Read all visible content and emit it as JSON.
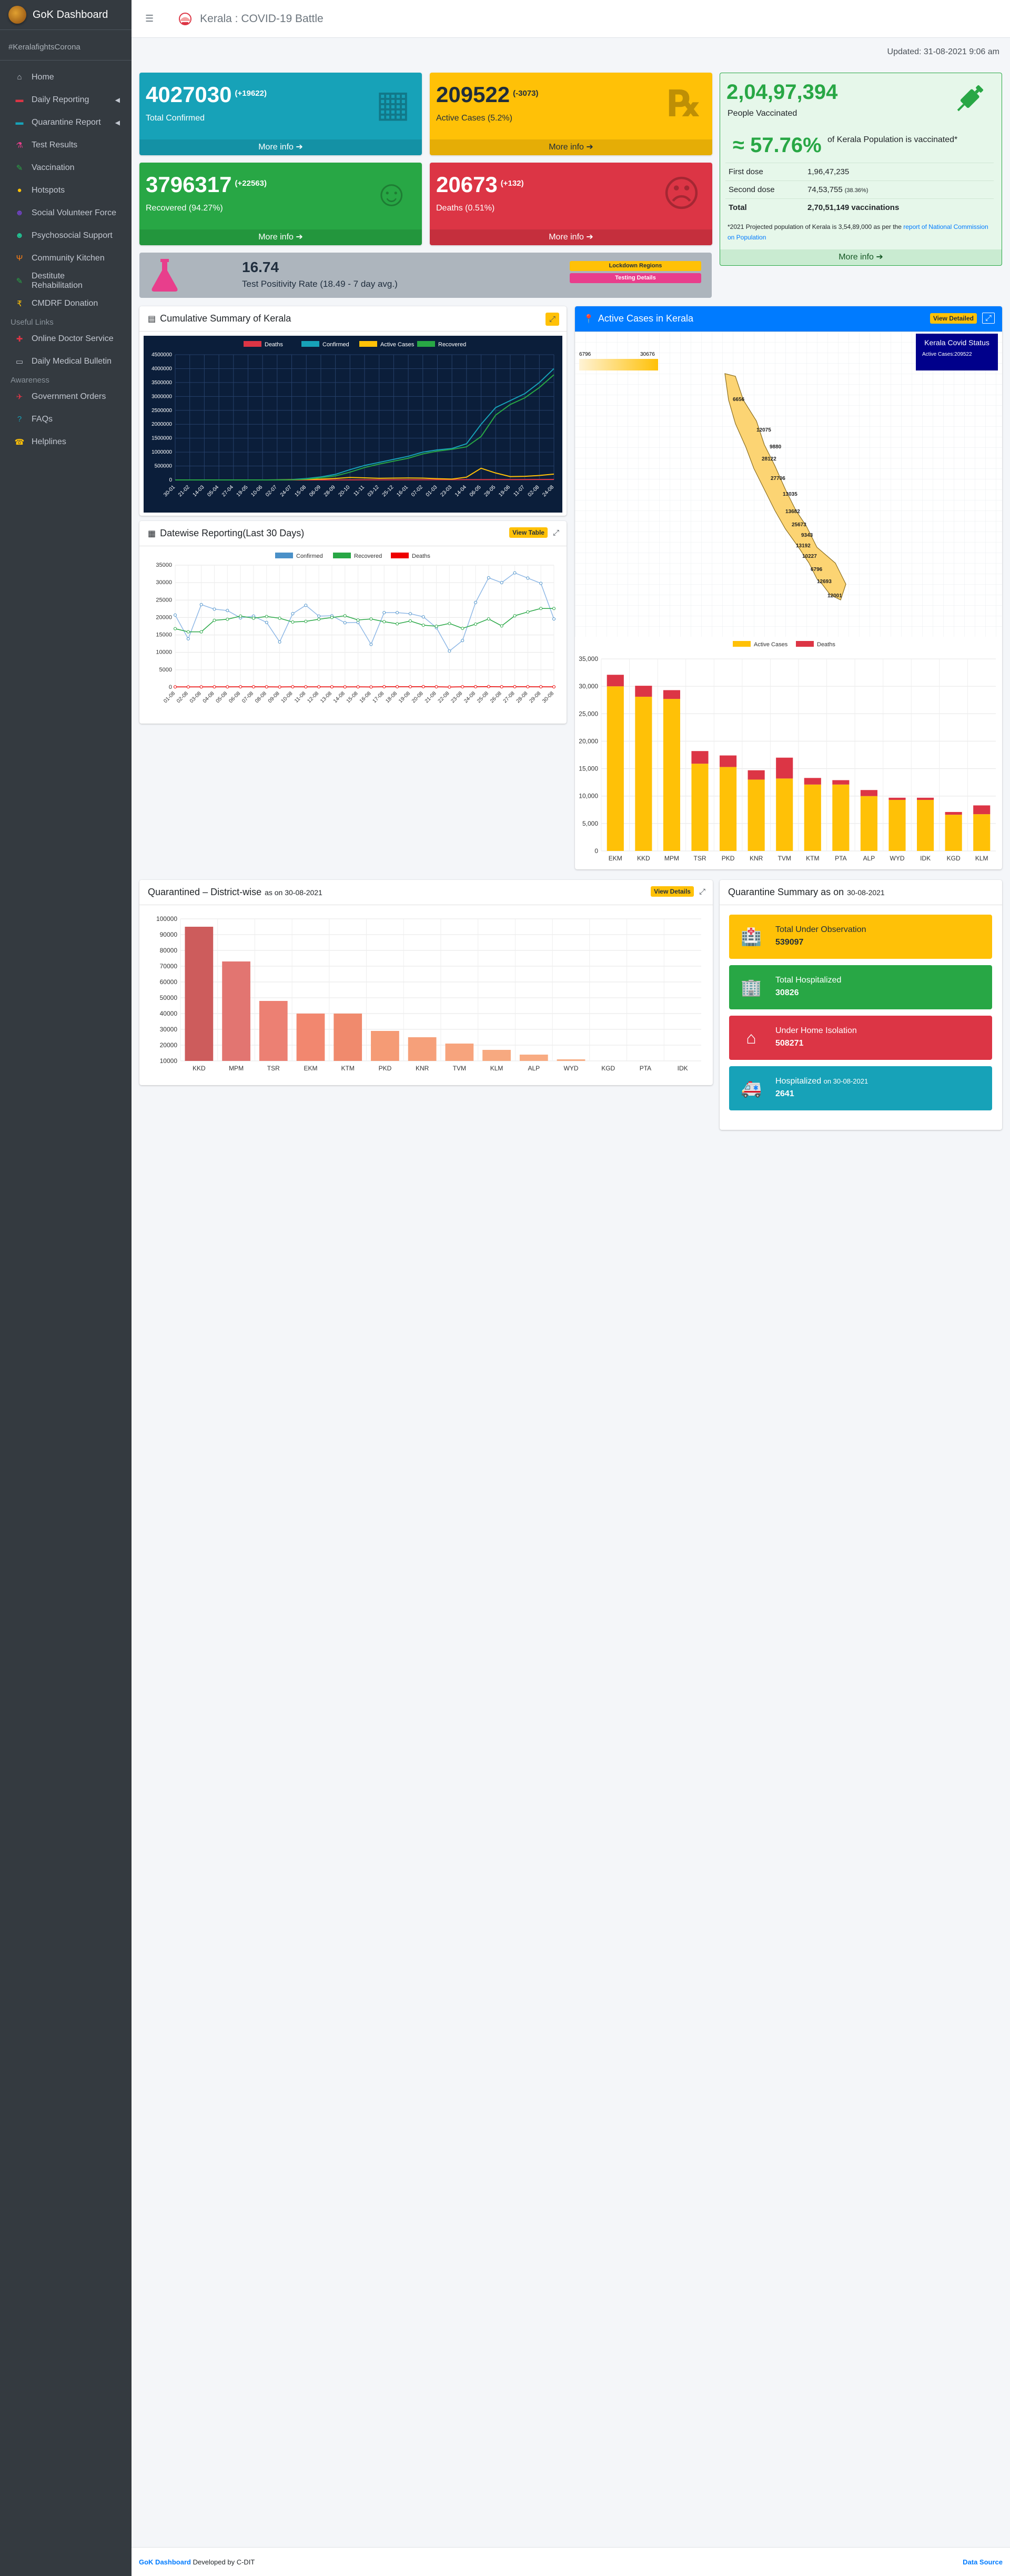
{
  "sidebar": {
    "brand": "GoK Dashboard",
    "hashtag": "#KeralafightsCorona",
    "items": [
      {
        "label": "Home",
        "icon": "⌂",
        "color": "#c2c7d0"
      },
      {
        "label": "Daily Reporting",
        "icon": "▬",
        "color": "#dc3545",
        "caret": true
      },
      {
        "label": "Quarantine Report",
        "icon": "▬",
        "color": "#17a2b8",
        "caret": true
      },
      {
        "label": "Test Results",
        "icon": "⚗",
        "color": "#e83e8c"
      },
      {
        "label": "Vaccination",
        "icon": "✎",
        "color": "#28a745"
      },
      {
        "label": "Hotspots",
        "icon": "●",
        "color": "#ffc107"
      },
      {
        "label": "Social Volunteer Force",
        "icon": "☻",
        "color": "#6f42c1"
      },
      {
        "label": "Psychosocial Support",
        "icon": "☻",
        "color": "#20c997"
      },
      {
        "label": "Community Kitchen",
        "icon": "Ψ",
        "color": "#fd7e14"
      },
      {
        "label": "Destitute Rehabilitation",
        "icon": "✎",
        "color": "#28a745"
      },
      {
        "label": "CMDRF Donation",
        "icon": "₹",
        "color": "#ffc107"
      }
    ],
    "useful_header": "Useful Links",
    "useful": [
      {
        "label": "Online Doctor Service",
        "icon": "✚",
        "color": "#dc3545"
      },
      {
        "label": "Daily Medical Bulletin",
        "icon": "▭",
        "color": "#c2c7d0"
      }
    ],
    "awareness_header": "Awareness",
    "awareness": [
      {
        "label": "Government Orders",
        "icon": "✈",
        "color": "#dc3545"
      },
      {
        "label": "FAQs",
        "icon": "?",
        "color": "#17a2b8"
      },
      {
        "label": "Helplines",
        "icon": "☎",
        "color": "#ffc107"
      }
    ]
  },
  "header": {
    "title": "Kerala : COVID-19 Battle"
  },
  "updated": "Updated: 31-08-2021 9:06 am",
  "boxes": {
    "confirmed": {
      "value": "4027030",
      "delta": "(+19622)",
      "label": "Total Confirmed",
      "more": "More info ➔"
    },
    "active": {
      "value": "209522",
      "delta": "(-3073)",
      "label": "Active Cases (5.2%)",
      "more": "More info ➔"
    },
    "recovered": {
      "value": "3796317",
      "delta": "(+22563)",
      "label": "Recovered (94.27%)",
      "more": "More info ➔"
    },
    "deaths": {
      "value": "20673",
      "delta": "(+132)",
      "label": "Deaths (0.51%)",
      "more": "More info ➔"
    }
  },
  "vaccination": {
    "people": "2,04,97,394",
    "people_label": "People Vaccinated",
    "pct": "≈ 57.76%",
    "pct_label": "of Kerala Population is vaccinated*",
    "rows": [
      {
        "k": "First dose",
        "v": "1,96,47,235",
        "extra": ""
      },
      {
        "k": "Second dose",
        "v": "74,53,755",
        "extra": "(38.36%)"
      },
      {
        "k": "Total",
        "v": "2,70,51,149 vaccinations",
        "extra": ""
      }
    ],
    "note": "*2021 Projected population of Kerala is 3,54,89,000 as per the",
    "note_link": "report of National Commission on Population",
    "more": "More info ➔"
  },
  "tpr": {
    "value": "16.74",
    "label": "Test Positivity Rate (18.49 - 7 day avg.)",
    "btn1": "Lockdown Regions",
    "btn2": "Testing Details"
  },
  "cumulative": {
    "title": "Cumulative Summary of Kerala",
    "legend": [
      "Deaths",
      "Confirmed",
      "Active Cases",
      "Recovered"
    ],
    "colors": [
      "#dc3545",
      "#17a2b8",
      "#ffc107",
      "#28a745"
    ]
  },
  "datewise": {
    "title": "Datewise Reporting(Last 30 Days)",
    "btn": "View Table",
    "legend": [
      "Confirmed",
      "Recovered",
      "Deaths"
    ],
    "colors": [
      "#4a90c8",
      "#28a745",
      "#e00"
    ]
  },
  "map": {
    "title": "Active Cases in Kerala",
    "btn": "View Detailed",
    "status_title": "Kerala Covid Status",
    "status_sub": "Active Cases:209522",
    "scale_min": "6796",
    "scale_max": "30676",
    "labels": [
      "6656",
      "12075",
      "9880",
      "28122",
      "27706",
      "13035",
      "13682",
      "25673",
      "9343",
      "13192",
      "10227",
      "6796",
      "12693",
      "12001"
    ]
  },
  "chart_data": [
    {
      "type": "line",
      "id": "cumulative",
      "title": "Cumulative Summary of Kerala",
      "yticks": [
        "4500000",
        "4000000",
        "3500000",
        "3000000",
        "2500000",
        "2000000",
        "1500000",
        "1000000",
        "500000",
        "0"
      ],
      "ylim": [
        0,
        4500000
      ],
      "x": [
        "30-01",
        "21-02",
        "14-03",
        "05-04",
        "27-04",
        "19-05",
        "10-06",
        "02-07",
        "24-07",
        "15-08",
        "06-09",
        "28-09",
        "20-10",
        "11-11",
        "03-12",
        "25-12",
        "16-01",
        "07-02",
        "01-03",
        "23-03",
        "14-04",
        "06-05",
        "28-05",
        "19-06",
        "11-07",
        "02-08",
        "24-08"
      ],
      "series": [
        {
          "name": "Deaths",
          "values": [
            0,
            0,
            0,
            0,
            0,
            0,
            0,
            0,
            100,
            400,
            1000,
            2000,
            3000,
            4000,
            5000,
            6000,
            7000,
            8000,
            9000,
            10000,
            11000,
            12000,
            13000,
            14000,
            15000,
            17000,
            20000
          ]
        },
        {
          "name": "Confirmed",
          "values": [
            0,
            0,
            0,
            0,
            0,
            0,
            0,
            2000,
            15000,
            50000,
            110000,
            200000,
            370000,
            520000,
            630000,
            740000,
            850000,
            1000000,
            1080000,
            1130000,
            1300000,
            2000000,
            2600000,
            2850000,
            3100000,
            3500000,
            4000000
          ]
        },
        {
          "name": "Active Cases",
          "values": [
            0,
            0,
            0,
            0,
            0,
            0,
            0,
            1500,
            10000,
            20000,
            30000,
            55000,
            90000,
            75000,
            60000,
            65000,
            70000,
            65000,
            45000,
            30000,
            100000,
            420000,
            250000,
            120000,
            130000,
            160000,
            210000
          ]
        },
        {
          "name": "Recovered",
          "values": [
            0,
            0,
            0,
            0,
            0,
            0,
            0,
            500,
            5000,
            30000,
            80000,
            145000,
            280000,
            445000,
            570000,
            675000,
            780000,
            935000,
            1035000,
            1100000,
            1190000,
            1560000,
            2330000,
            2710000,
            2950000,
            3320000,
            3780000
          ]
        }
      ]
    },
    {
      "type": "line",
      "id": "datewise",
      "title": "Datewise Reporting(Last 30 Days)",
      "yticks": [
        "35000",
        "30000",
        "25000",
        "20000",
        "15000",
        "10000",
        "5000",
        "0"
      ],
      "ylim": [
        0,
        35000
      ],
      "x": [
        "01-08",
        "02-08",
        "03-08",
        "04-08",
        "05-08",
        "06-08",
        "07-08",
        "08-08",
        "09-08",
        "10-08",
        "11-08",
        "12-08",
        "13-08",
        "14-08",
        "15-08",
        "16-08",
        "17-08",
        "18-08",
        "19-08",
        "20-08",
        "21-08",
        "22-08",
        "23-08",
        "24-08",
        "25-08",
        "26-08",
        "27-08",
        "28-08",
        "29-08",
        "30-08"
      ],
      "series": [
        {
          "name": "Confirmed",
          "values": [
            20700,
            13900,
            23700,
            22400,
            22000,
            19900,
            20400,
            18600,
            13000,
            21100,
            23500,
            20400,
            20500,
            18500,
            18600,
            12300,
            21400,
            21400,
            21100,
            20200,
            17100,
            10400,
            13400,
            24300,
            31400,
            30000,
            32800,
            31300,
            29800,
            19600
          ]
        },
        {
          "name": "Recovered",
          "values": [
            16800,
            15900,
            15900,
            19200,
            19500,
            20400,
            19800,
            20300,
            19800,
            18700,
            18900,
            19500,
            20000,
            20500,
            19300,
            19600,
            18800,
            18200,
            19000,
            17800,
            17500,
            18300,
            16900,
            18100,
            19600,
            17600,
            20500,
            21600,
            22600,
            22600
          ]
        },
        {
          "name": "Deaths",
          "values": [
            116,
            118,
            122,
            135,
            128,
            146,
            148,
            133,
            102,
            156,
            137,
            130,
            134,
            114,
            125,
            101,
            163,
            178,
            162,
            181,
            148,
            82,
            160,
            173,
            215,
            149,
            168,
            165,
            153,
            132
          ]
        }
      ]
    },
    {
      "type": "bar",
      "id": "districts-active",
      "categories": [
        "EKM",
        "KKD",
        "MPM",
        "TSR",
        "PKD",
        "KNR",
        "TVM",
        "KTM",
        "PTA",
        "ALP",
        "WYD",
        "IDK",
        "KGD",
        "KLM"
      ],
      "series": [
        {
          "name": "Active Cases",
          "values": [
            30000,
            28100,
            27700,
            15900,
            15300,
            13000,
            13200,
            12100,
            12100,
            10000,
            9300,
            9300,
            6600,
            6700
          ]
        },
        {
          "name": "Deaths",
          "values": [
            2100,
            2000,
            1600,
            2300,
            2100,
            1700,
            3800,
            1200,
            800,
            1100,
            400,
            400,
            500,
            1600
          ]
        }
      ],
      "legend": [
        "Active Cases",
        "Deaths"
      ],
      "yticks": [
        "35,000",
        "30,000",
        "25,000",
        "20,000",
        "15,000",
        "10,000",
        "5,000",
        "0"
      ],
      "ylim": [
        0,
        35000
      ]
    },
    {
      "type": "bar",
      "id": "quarantined",
      "title": "Quarantined – District-wise",
      "categories": [
        "KKD",
        "MPM",
        "TSR",
        "EKM",
        "KTM",
        "PKD",
        "KNR",
        "TVM",
        "KLM",
        "ALP",
        "WYD",
        "KGD",
        "PTA",
        "IDK"
      ],
      "values": [
        95000,
        73000,
        48000,
        40000,
        40000,
        29000,
        25000,
        21000,
        17000,
        14000,
        11000,
        9000,
        7000,
        6500
      ],
      "yticks": [
        "100000",
        "90000",
        "80000",
        "70000",
        "60000",
        "50000",
        "40000",
        "30000",
        "20000",
        "10000"
      ],
      "ylim": [
        10000,
        100000
      ]
    }
  ],
  "quarantined": {
    "title": "Quarantined – District-wise",
    "asof": "as on 30-08-2021",
    "btn": "View Details"
  },
  "qsummary": {
    "title": "Quarantine Summary as on",
    "date": "30-08-2021",
    "items": [
      {
        "label": "Total Under Observation",
        "sub": "",
        "value": "539097",
        "icon": "🏥",
        "color": "#ffc107"
      },
      {
        "label": "Total Hospitalized",
        "sub": "",
        "value": "30826",
        "icon": "🏢",
        "color": "#28a745"
      },
      {
        "label": "Under Home Isolation",
        "sub": "",
        "value": "508271",
        "icon": "⌂",
        "color": "#dc3545"
      },
      {
        "label": "Hospitalized",
        "sub": "on 30-08-2021",
        "value": "2641",
        "icon": "🚑",
        "color": "#17a2b8"
      }
    ]
  },
  "footer": {
    "brand": "GoK Dashboard",
    "dev": "Developed by C-DIT",
    "source": "Data Source"
  }
}
